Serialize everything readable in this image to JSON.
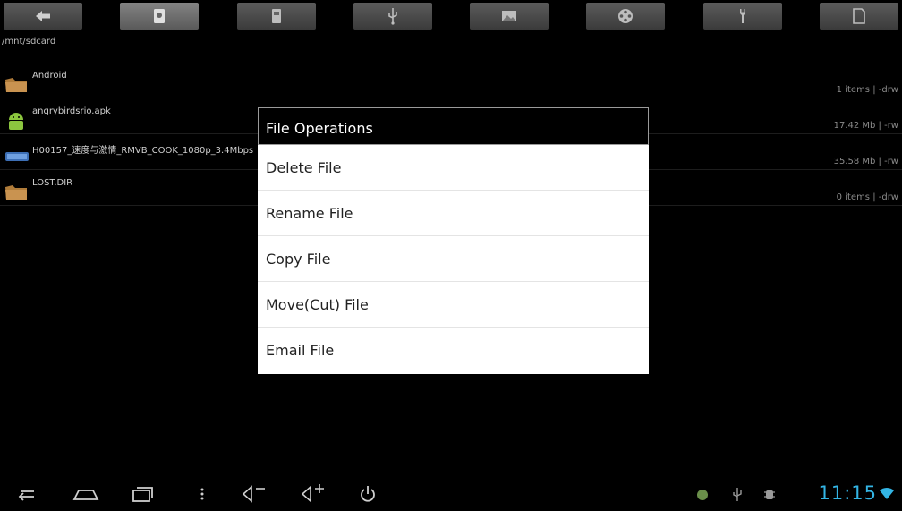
{
  "toolbar": {
    "buttons": [
      {
        "icon": "back-arrow-icon"
      },
      {
        "icon": "sdcard-icon"
      },
      {
        "icon": "internal-storage-icon"
      },
      {
        "icon": "usb-icon"
      },
      {
        "icon": "image-icon"
      },
      {
        "icon": "film-reel-icon"
      },
      {
        "icon": "tools-icon"
      },
      {
        "icon": "document-icon"
      }
    ],
    "active_index": 1
  },
  "path": "/mnt/sdcard",
  "files": [
    {
      "name": "Android",
      "info": "1 items | -drw",
      "icon": "folder-icon"
    },
    {
      "name": "angrybirdsrio.apk",
      "info": "17.42 Mb | -rw",
      "icon": "android-app-icon"
    },
    {
      "name": "H00157_速度与激情_RMVB_COOK_1080p_3.4Mbps",
      "info": "35.58 Mb | -rw",
      "icon": "video-file-icon"
    },
    {
      "name": "LOST.DIR",
      "info": "0 items | -drw",
      "icon": "folder-icon"
    }
  ],
  "dialog": {
    "title": "File Operations",
    "items": [
      "Delete File",
      "Rename File",
      "Copy File",
      "Move(Cut) File",
      "Email File"
    ]
  },
  "navbar": {
    "clock": "11:15"
  },
  "colors": {
    "accent": "#33b5e5",
    "background": "#000000",
    "dialog_bg": "#ffffff"
  }
}
